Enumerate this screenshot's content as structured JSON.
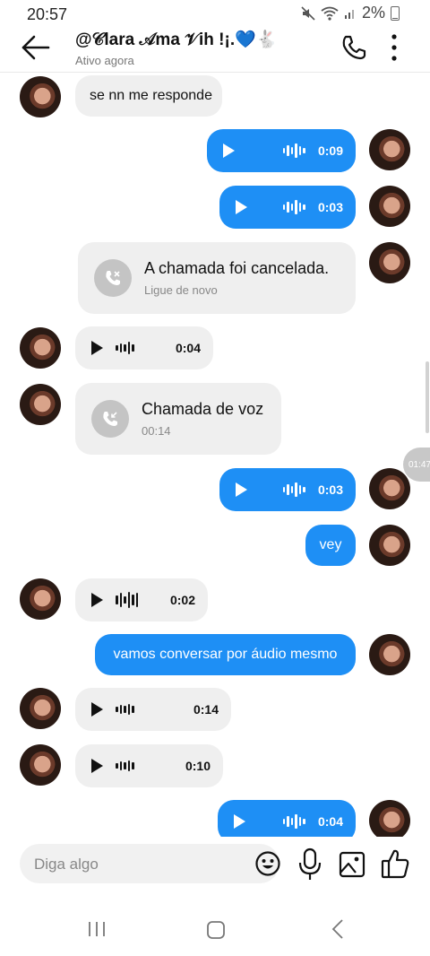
{
  "status_bar": {
    "time": "20:57",
    "battery": "2%"
  },
  "header": {
    "title": "@𝒞lara 𝒜ma 𝒱ih !¡.💙🐇",
    "subtitle": "Ativo agora"
  },
  "messages": [
    {
      "type": "text",
      "dir": "in",
      "text": "se nn me responde"
    },
    {
      "type": "audio",
      "dir": "out",
      "duration": "0:09"
    },
    {
      "type": "audio",
      "dir": "out",
      "duration": "0:03"
    },
    {
      "type": "call",
      "dir": "out",
      "title": "A chamada foi cancelada.",
      "subtitle": "Ligue de novo"
    },
    {
      "type": "audio",
      "dir": "in",
      "duration": "0:04"
    },
    {
      "type": "call",
      "dir": "in",
      "title": "Chamada de voz",
      "subtitle": "00:14"
    },
    {
      "type": "audio",
      "dir": "out",
      "duration": "0:03"
    },
    {
      "type": "text",
      "dir": "out",
      "text": "vey"
    },
    {
      "type": "audio",
      "dir": "in",
      "duration": "0:02"
    },
    {
      "type": "text",
      "dir": "out",
      "text": "vamos conversar  por áudio mesmo"
    },
    {
      "type": "audio",
      "dir": "in",
      "duration": "0:14"
    },
    {
      "type": "audio",
      "dir": "in",
      "duration": "0:10"
    },
    {
      "type": "audio",
      "dir": "out",
      "duration": "0:04"
    }
  ],
  "side_time": "01:47",
  "composer": {
    "placeholder": "Diga algo"
  },
  "icons": {
    "back": "arrow-left-icon",
    "call": "phone-icon",
    "more": "more-vertical-icon",
    "emoji": "smile-icon",
    "mic": "mic-icon",
    "image": "image-icon",
    "like": "thumbs-up-icon"
  },
  "colors": {
    "outgoing": "#1e8ff5",
    "incoming": "#efefef",
    "accent": "#0095f6"
  }
}
